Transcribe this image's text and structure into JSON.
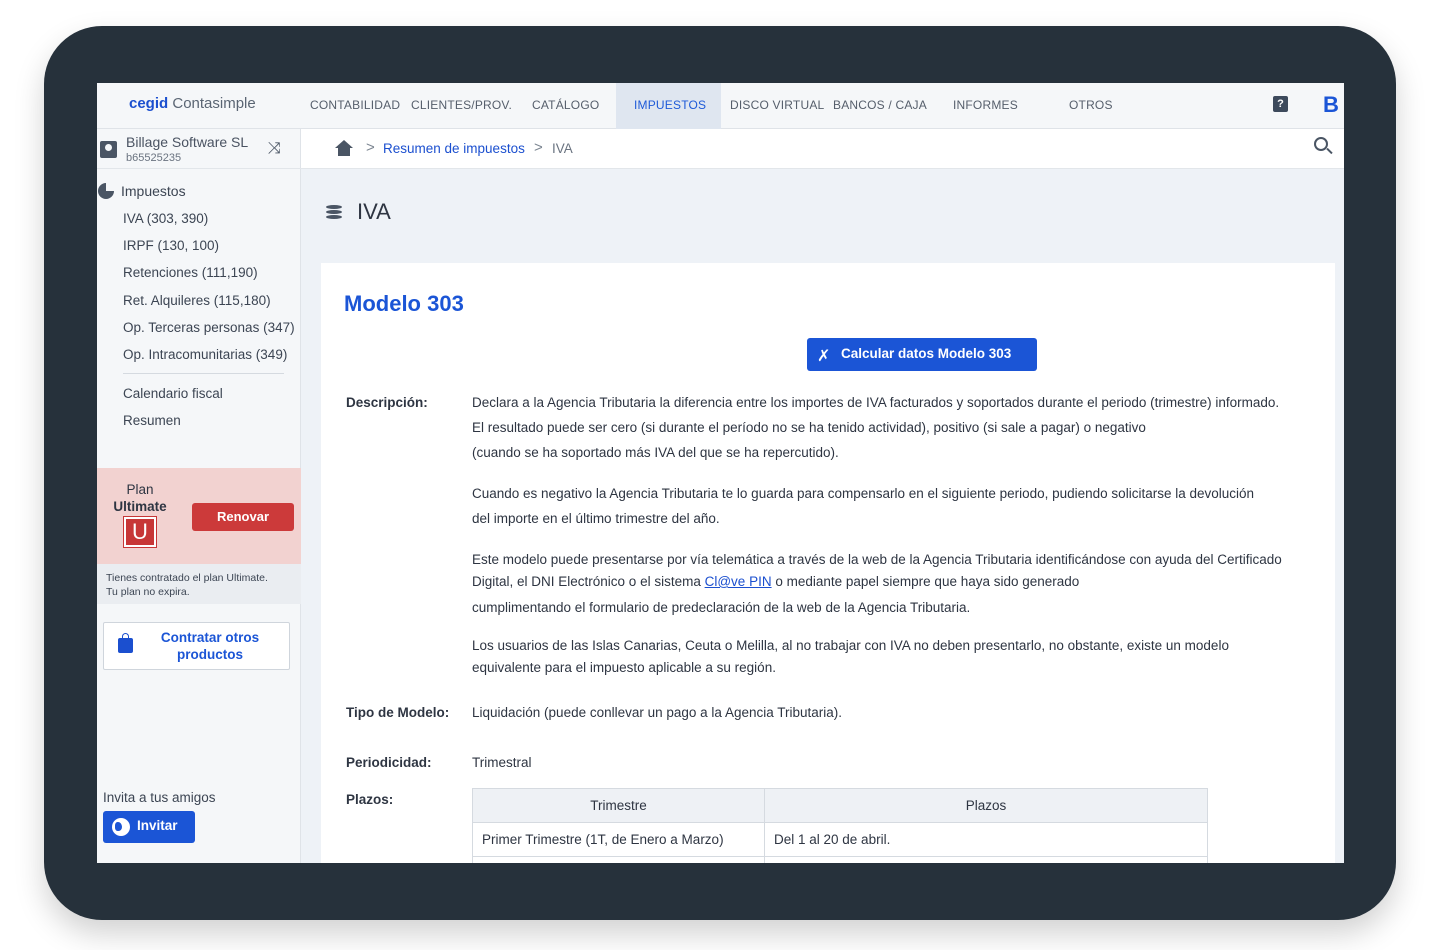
{
  "app": {
    "logo_brand": "cegid",
    "logo_product": "Contasimple",
    "brand_letter": "B"
  },
  "nav": {
    "items": [
      "CONTABILIDAD",
      "CLIENTES/PROV.",
      "CATÁLOGO",
      "IMPUESTOS",
      "DISCO VIRTUAL",
      "BANCOS / CAJA",
      "INFORMES",
      "OTROS"
    ],
    "active": "IMPUESTOS",
    "help_glyph": "?"
  },
  "company": {
    "name": "Billage Software SL",
    "id": "b65525235"
  },
  "sidebar": {
    "section_title": "Impuestos",
    "items": [
      "IVA (303, 390)",
      "IRPF (130, 100)",
      "Retenciones (111,190)",
      "Ret. Alquileres (115,180)",
      "Op. Terceras personas (347)",
      "Op. Intracomunitarias (349)"
    ],
    "extra_items": [
      "Calendario fiscal",
      "Resumen"
    ]
  },
  "plan": {
    "label": "Plan",
    "name": "Ultimate",
    "badge": "U",
    "renew_label": "Renovar",
    "info_line1": "Tienes contratado el plan Ultimate.",
    "info_line2": "Tu plan no expira."
  },
  "contract": {
    "line1": "Contratar otros",
    "line2": "productos"
  },
  "invite": {
    "label": "Invita a tus amigos",
    "button": "Invitar"
  },
  "breadcrumb": {
    "link": "Resumen de impuestos",
    "current": "IVA",
    "separator": ">"
  },
  "page": {
    "title": "IVA"
  },
  "card": {
    "title": "Modelo 303",
    "calc_button": "Calcular datos Modelo 303",
    "desc_label": "Descripción:",
    "desc": [
      "Declara a la Agencia Tributaria la diferencia entre los importes de IVA facturados y soportados durante el periodo (trimestre) informado.",
      "El resultado puede ser cero (si durante el período no se ha tenido actividad), positivo (si sale a pagar) o negativo",
      "(cuando se ha soportado más IVA del que se ha repercutido).",
      "Cuando es negativo la Agencia Tributaria te lo guarda para compensarlo en el siguiente periodo, pudiendo solicitarse la devolución",
      "del importe en el último trimestre del año.",
      "Este modelo puede presentarse por vía telemática a través de la web de la Agencia Tributaria identificándose con ayuda del Certificado",
      "Digital, el DNI Electrónico o el sistema",
      "Cl@ve PIN",
      "o mediante papel siempre que haya sido generado",
      "cumplimentando el formulario de predeclaración de la web de la Agencia Tributaria.",
      "Los usuarios de las Islas Canarias, Ceuta o Melilla, al no trabajar con IVA no deben presentarlo, no obstante, existe un modelo",
      "equivalente para el impuesto aplicable a su región."
    ],
    "tipo_label": "Tipo de Modelo:",
    "tipo_value": "Liquidación (puede conllevar un pago a la Agencia Tributaria).",
    "periodicidad_label": "Periodicidad:",
    "periodicidad_value": "Trimestral",
    "plazos_label": "Plazos:",
    "table": {
      "headers": [
        "Trimestre",
        "Plazos"
      ],
      "rows": [
        [
          "Primer Trimestre (1T, de Enero a Marzo)",
          "Del 1 al 20 de abril."
        ]
      ]
    }
  },
  "colors": {
    "accent": "#1b55d6",
    "renew": "#cc3a3a",
    "plan_bg": "#f2d2d0",
    "bezel": "#26313b"
  }
}
